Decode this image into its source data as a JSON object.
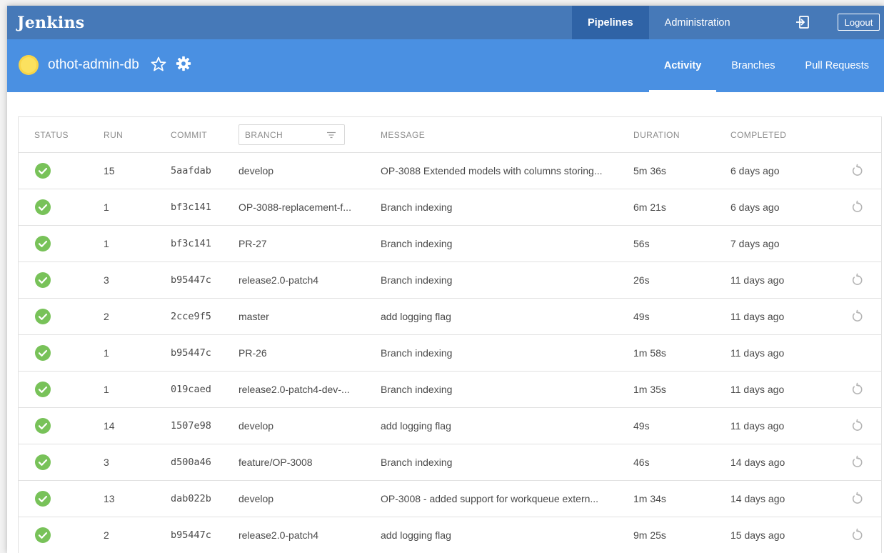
{
  "topbar": {
    "brand": "Jenkins",
    "nav": [
      {
        "label": "Pipelines",
        "active": true
      },
      {
        "label": "Administration",
        "active": false
      }
    ],
    "exit_icon": "sign-out-icon",
    "logout_label": "Logout"
  },
  "pipeline": {
    "name": "othot-admin-db",
    "weather_icon": "sunny-icon",
    "tabs": [
      {
        "label": "Activity",
        "active": true
      },
      {
        "label": "Branches",
        "active": false
      },
      {
        "label": "Pull Requests",
        "active": false
      }
    ]
  },
  "table": {
    "headers": {
      "status": "STATUS",
      "run": "RUN",
      "commit": "COMMIT",
      "branch": "BRANCH",
      "message": "MESSAGE",
      "duration": "DURATION",
      "completed": "COMPLETED"
    },
    "rows": [
      {
        "status": "success",
        "run": "15",
        "commit": "5aafdab",
        "branch": "develop",
        "message": "OP-3088 Extended models with columns storing...",
        "duration": "5m 36s",
        "completed": "6 days ago",
        "rerun": true
      },
      {
        "status": "success",
        "run": "1",
        "commit": "bf3c141",
        "branch": "OP-3088-replacement-f...",
        "message": "Branch indexing",
        "duration": "6m 21s",
        "completed": "6 days ago",
        "rerun": true
      },
      {
        "status": "success",
        "run": "1",
        "commit": "bf3c141",
        "branch": "PR-27",
        "message": "Branch indexing",
        "duration": "56s",
        "completed": "7 days ago",
        "rerun": false
      },
      {
        "status": "success",
        "run": "3",
        "commit": "b95447c",
        "branch": "release2.0-patch4",
        "message": "Branch indexing",
        "duration": "26s",
        "completed": "11 days ago",
        "rerun": true
      },
      {
        "status": "success",
        "run": "2",
        "commit": "2cce9f5",
        "branch": "master",
        "message": "add logging flag",
        "duration": "49s",
        "completed": "11 days ago",
        "rerun": true
      },
      {
        "status": "success",
        "run": "1",
        "commit": "b95447c",
        "branch": "PR-26",
        "message": "Branch indexing",
        "duration": "1m 58s",
        "completed": "11 days ago",
        "rerun": false
      },
      {
        "status": "success",
        "run": "1",
        "commit": "019caed",
        "branch": "release2.0-patch4-dev-...",
        "message": "Branch indexing",
        "duration": "1m 35s",
        "completed": "11 days ago",
        "rerun": true
      },
      {
        "status": "success",
        "run": "14",
        "commit": "1507e98",
        "branch": "develop",
        "message": "add logging flag",
        "duration": "49s",
        "completed": "11 days ago",
        "rerun": true
      },
      {
        "status": "success",
        "run": "3",
        "commit": "d500a46",
        "branch": "feature/OP-3008",
        "message": "Branch indexing",
        "duration": "46s",
        "completed": "14 days ago",
        "rerun": true
      },
      {
        "status": "success",
        "run": "13",
        "commit": "dab022b",
        "branch": "develop",
        "message": "OP-3008 - added support for workqueue extern...",
        "duration": "1m 34s",
        "completed": "14 days ago",
        "rerun": true
      },
      {
        "status": "success",
        "run": "2",
        "commit": "b95447c",
        "branch": "release2.0-patch4",
        "message": "add logging flag",
        "duration": "9m 25s",
        "completed": "15 days ago",
        "rerun": true
      }
    ]
  },
  "colors": {
    "topbar": "#4679b8",
    "topbar_active": "#2f63a6",
    "pipebar": "#4a90e2",
    "success": "#78c259",
    "weather": "#f8d548"
  }
}
